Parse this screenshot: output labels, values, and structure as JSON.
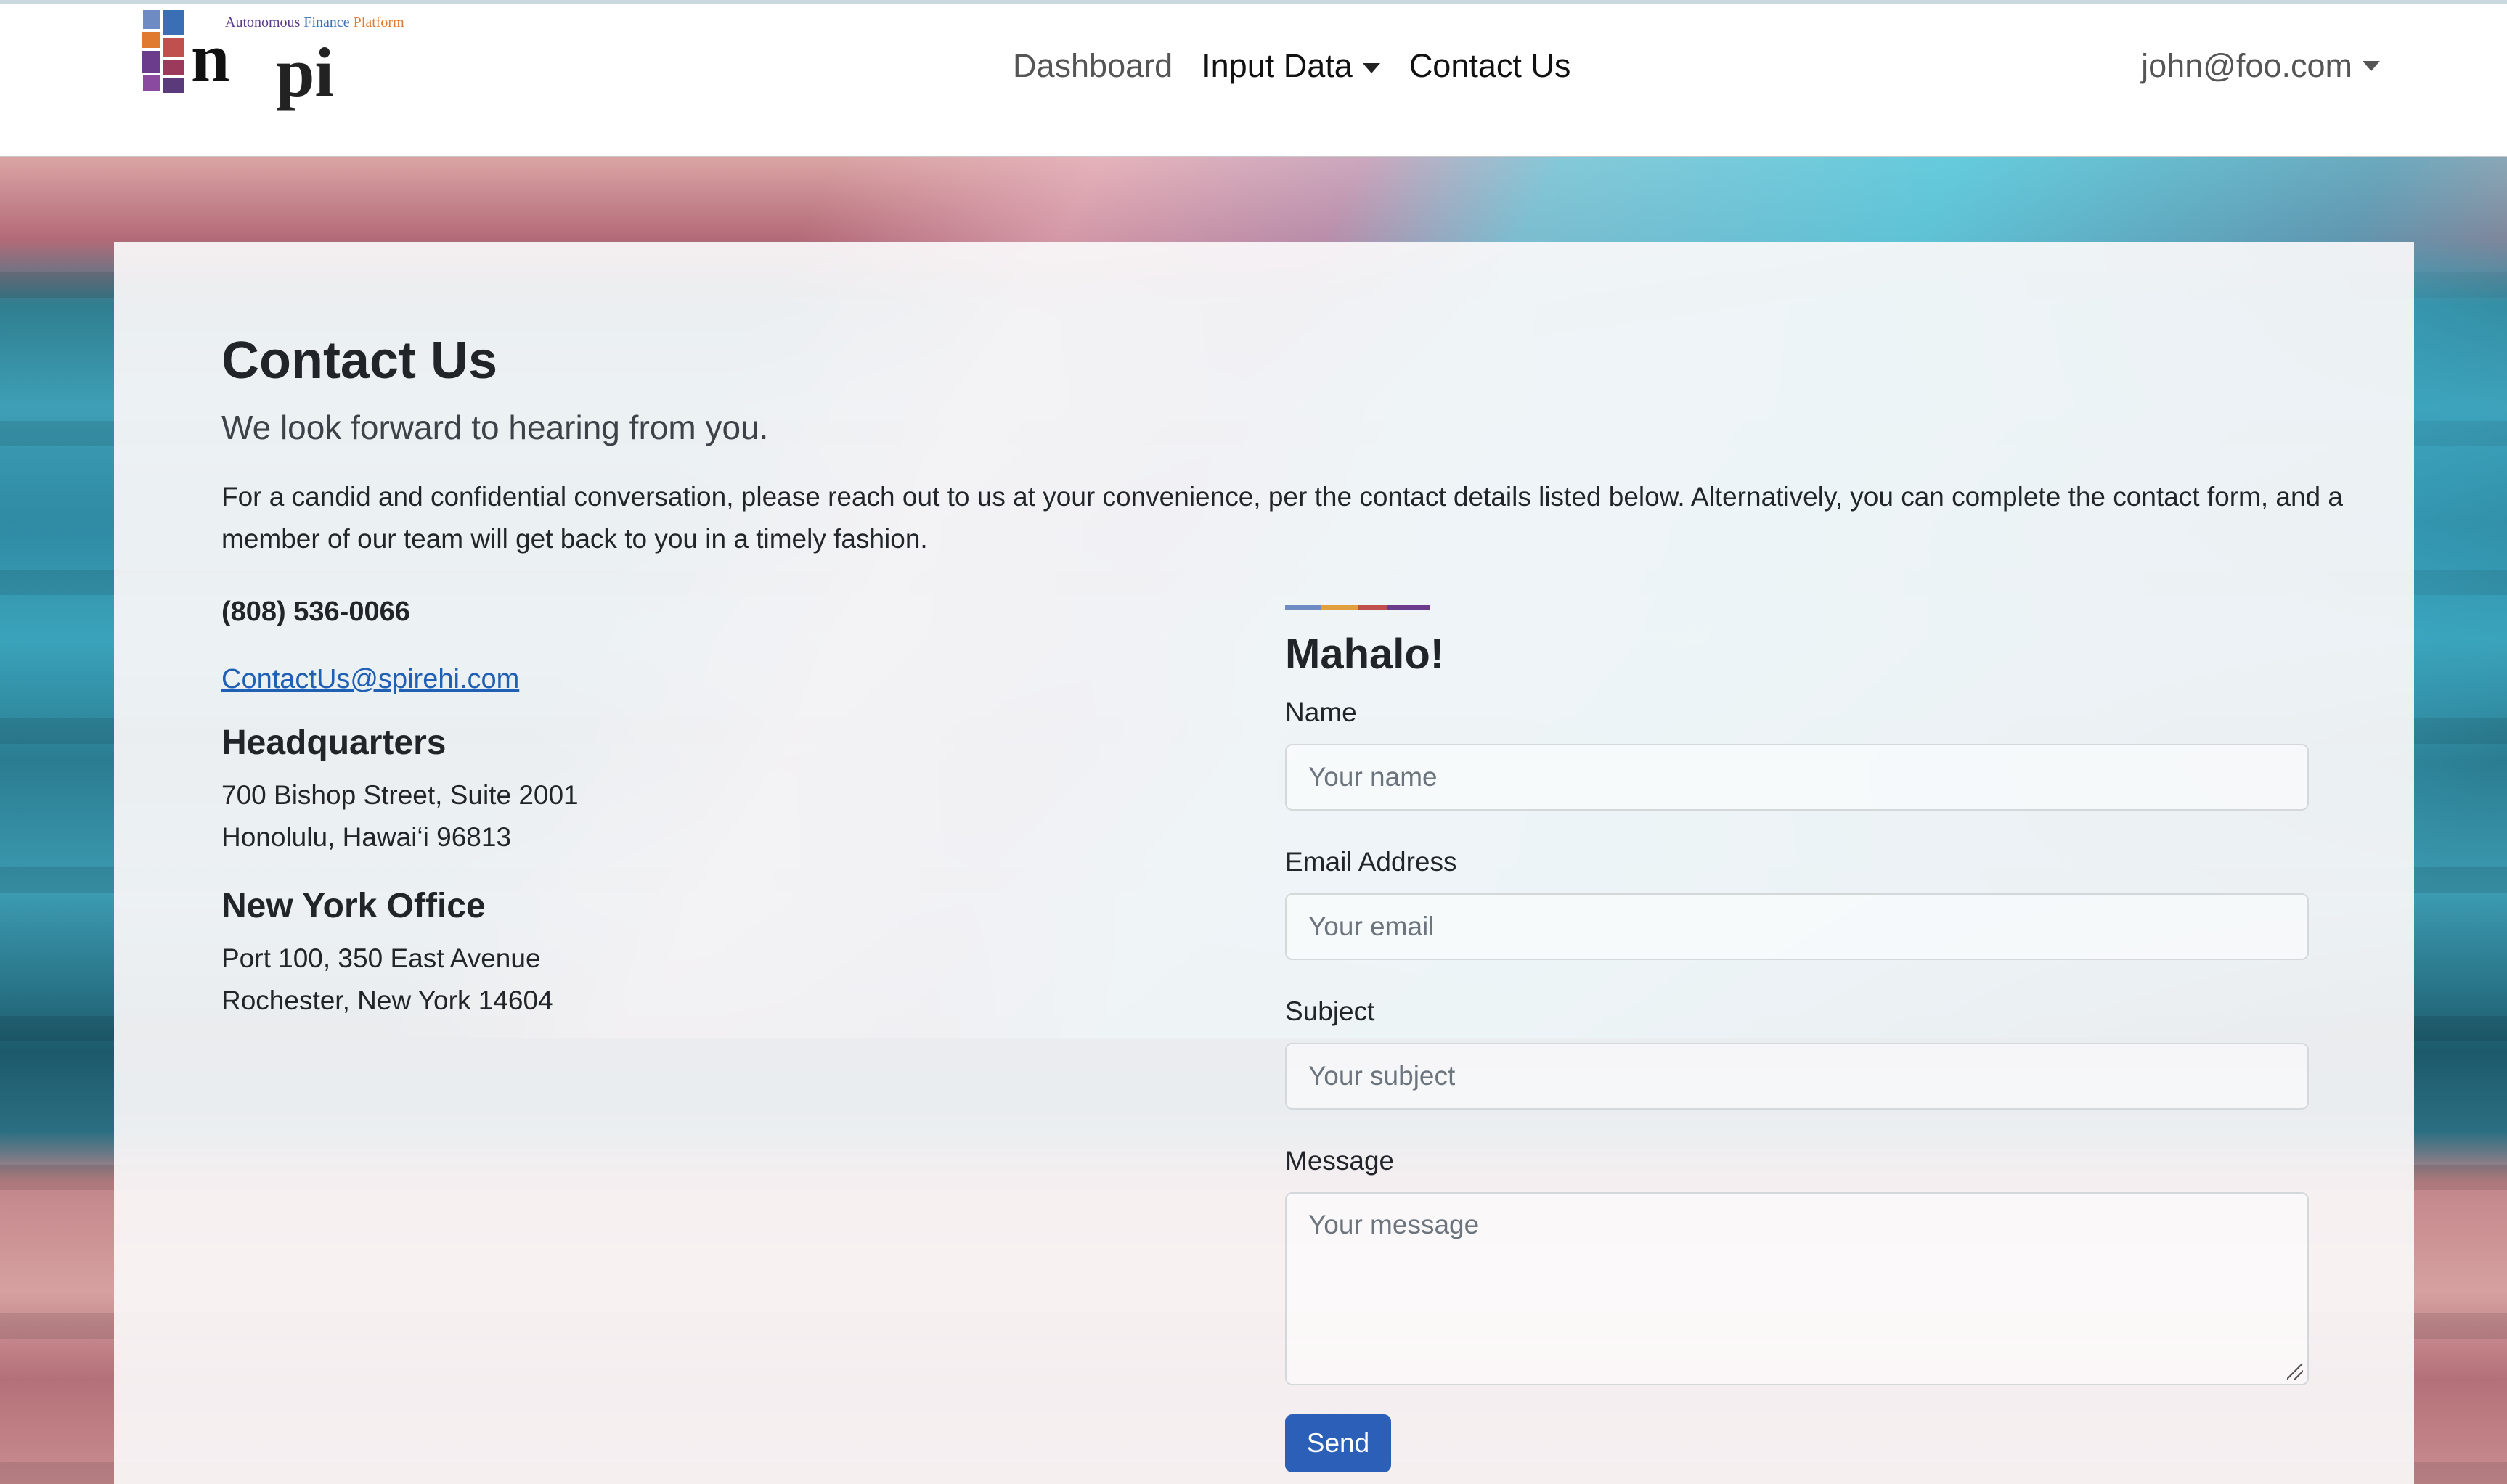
{
  "brand": {
    "tagline_part1": "Autonomous",
    "tagline_part2": "Finance",
    "tagline_part3": "Platform",
    "logo_letter_n": "n",
    "logo_letter_pi": "pi"
  },
  "nav": {
    "dashboard": "Dashboard",
    "input_data": "Input Data",
    "contact_us": "Contact Us",
    "user": "john@foo.com"
  },
  "page": {
    "title": "Contact Us",
    "lead": "We look forward to hearing from you.",
    "intro": "For a candid and confidential conversation, please reach out to us at your convenience, per the contact details listed below. Alternatively, you can complete the contact form, and a member of our team will get back to you in a timely fashion."
  },
  "contact": {
    "phone": "(808) 536-0066",
    "email": "ContactUs@spirehi.com",
    "offices": [
      {
        "title": "Headquarters",
        "line1": "700 Bishop Street, Suite 2001",
        "line2": "Honolulu, Hawai‘i 96813"
      },
      {
        "title": "New York Office",
        "line1": "Port 100, 350 East Avenue",
        "line2": "Rochester, New York 14604"
      }
    ]
  },
  "form": {
    "title": "Mahalo!",
    "name_label": "Name",
    "name_placeholder": "Your name",
    "email_label": "Email Address",
    "email_placeholder": "Your email",
    "subject_label": "Subject",
    "subject_placeholder": "Your subject",
    "message_label": "Message",
    "message_placeholder": "Your message",
    "send_label": "Send"
  },
  "colors": {
    "primary_button": "#2b5fb8",
    "link": "#1f5fb4"
  }
}
